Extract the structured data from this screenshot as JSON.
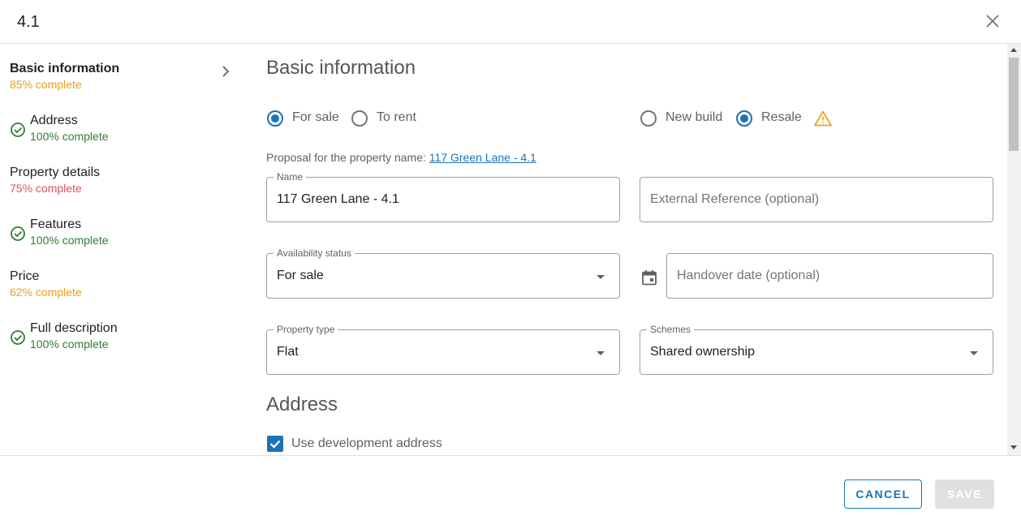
{
  "dialog": {
    "title": "4.1"
  },
  "sidebar": {
    "items": [
      {
        "label": "Basic information",
        "status": "85% complete"
      },
      {
        "label": "Address",
        "status": "100% complete"
      },
      {
        "label": "Property details",
        "status": "75% complete"
      },
      {
        "label": "Features",
        "status": "100% complete"
      },
      {
        "label": "Price",
        "status": "62% complete"
      },
      {
        "label": "Full description",
        "status": "100% complete"
      }
    ]
  },
  "main": {
    "section_basic": "Basic information",
    "listing_type": {
      "for_sale": "For sale",
      "to_rent": "To rent",
      "selected": "For sale"
    },
    "build_type": {
      "new_build": "New build",
      "resale": "Resale",
      "selected": "Resale"
    },
    "proposal": {
      "prefix": "Proposal for the property name: ",
      "link": "117 Green Lane - 4.1"
    },
    "name_field": {
      "label": "Name",
      "value": "117 Green Lane - 4.1"
    },
    "external_ref": {
      "placeholder": "External Reference (optional)"
    },
    "availability": {
      "label": "Availability status",
      "value": "For sale"
    },
    "handover": {
      "placeholder": "Handover date (optional)"
    },
    "property_type": {
      "label": "Property type",
      "value": "Flat"
    },
    "schemes": {
      "label": "Schemes",
      "value": "Shared ownership"
    },
    "section_address": "Address",
    "use_dev_address": {
      "label": "Use development address",
      "checked": true
    }
  },
  "footer": {
    "cancel": "CANCEL",
    "save": "SAVE"
  },
  "colors": {
    "accent": "#1a73b8",
    "complete": "#2e7d32",
    "partial": "#e6a01d",
    "low": "#e05151",
    "warning": "#f0a020"
  }
}
